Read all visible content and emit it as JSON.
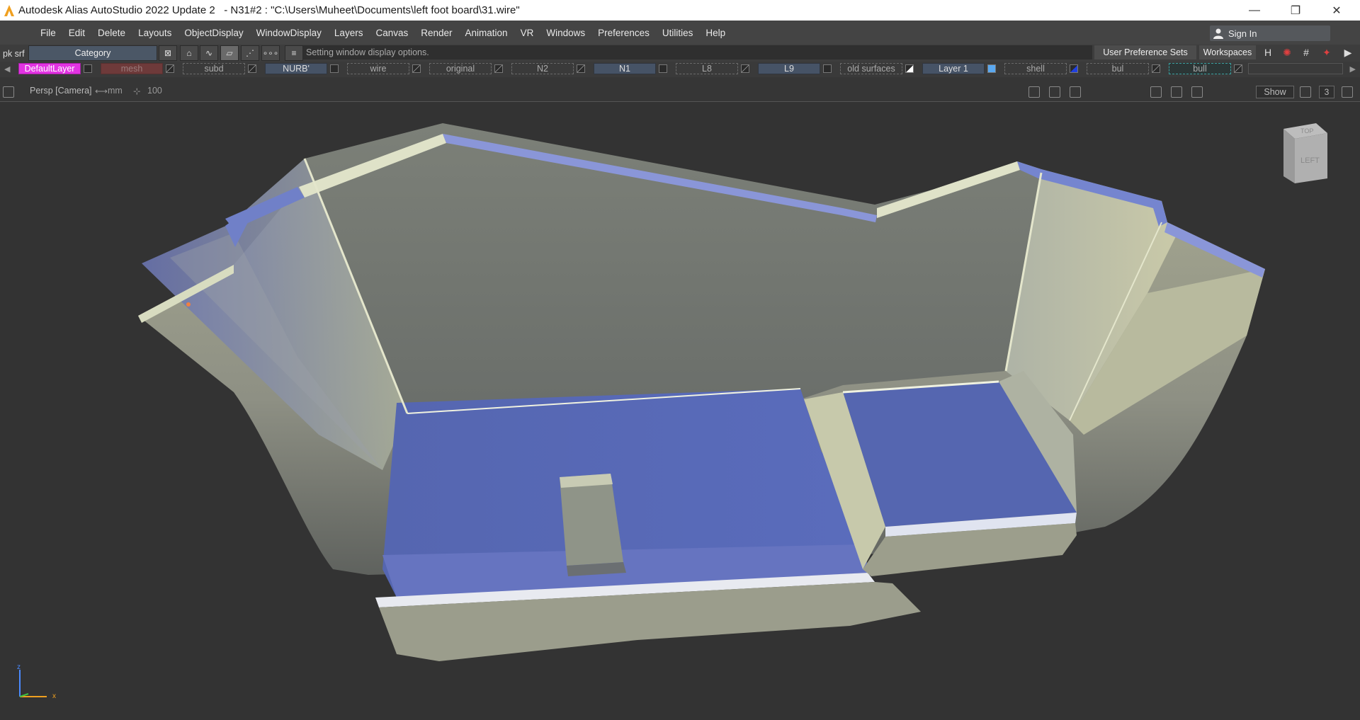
{
  "titlebar": {
    "app_title": "Autodesk Alias AutoStudio 2022 Update 2",
    "file_info": "   - N31#2 : \"C:\\Users\\Muheet\\Documents\\left foot board\\31.wire\"",
    "controls": {
      "minimize": "—",
      "restore": "❐",
      "close": "✕"
    }
  },
  "menubar": {
    "items": [
      "File",
      "Edit",
      "Delete",
      "Layouts",
      "ObjectDisplay",
      "WindowDisplay",
      "Layers",
      "Canvas",
      "Render",
      "Animation",
      "VR",
      "Windows",
      "Preferences",
      "Utilities",
      "Help"
    ],
    "sign_in": "Sign In"
  },
  "toolbar": {
    "pick": "pk srf",
    "category": "Category",
    "prompt": "Setting window display options.",
    "user_pref": "User Preference Sets",
    "workspaces": "Workspaces"
  },
  "layers": [
    {
      "name": "DefaultLayer"
    },
    {
      "name": "mesh"
    },
    {
      "name": "subd"
    },
    {
      "name": "NURB'"
    },
    {
      "name": "wire"
    },
    {
      "name": "original"
    },
    {
      "name": "N2"
    },
    {
      "name": "N1"
    },
    {
      "name": "L8"
    },
    {
      "name": "L9"
    },
    {
      "name": "old surfaces"
    },
    {
      "name": "Layer 1"
    },
    {
      "name": "shell"
    },
    {
      "name": "bul"
    },
    {
      "name": "bull"
    }
  ],
  "viewport": {
    "camera": "Persp [Camera]",
    "units": "mm",
    "grid": "100",
    "show": "Show",
    "count": "3",
    "viewcube_top": "TOP",
    "viewcube_left": "LEFT",
    "axis_x": "x",
    "axis_z": "z"
  },
  "colors": {
    "surface_light": "#c9c9a8",
    "surface_blue": "#5566b0",
    "background": "#333333",
    "default_layer": "#e233e2"
  }
}
